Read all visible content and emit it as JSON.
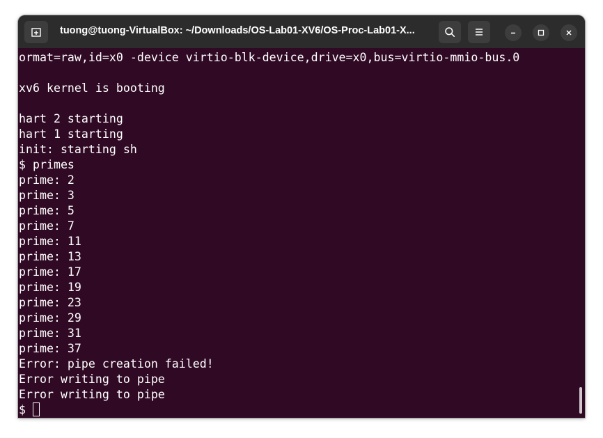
{
  "window": {
    "title": "tuong@tuong-VirtualBox: ~/Downloads/OS-Lab01-XV6/OS-Proc-Lab01-X..."
  },
  "toolbar": {
    "new_tab_icon": "new-tab-icon",
    "search_icon": "search-icon",
    "menu_icon": "hamburger-menu-icon",
    "minimize_icon": "minimize-icon",
    "maximize_icon": "maximize-icon",
    "close_icon": "close-icon"
  },
  "terminal": {
    "lines": [
      "ormat=raw,id=x0 -device virtio-blk-device,drive=x0,bus=virtio-mmio-bus.0",
      "",
      "xv6 kernel is booting",
      "",
      "hart 2 starting",
      "hart 1 starting",
      "init: starting sh",
      "$ primes",
      "prime: 2",
      "prime: 3",
      "prime: 5",
      "prime: 7",
      "prime: 11",
      "prime: 13",
      "prime: 17",
      "prime: 19",
      "prime: 23",
      "prime: 29",
      "prime: 31",
      "prime: 37",
      "Error: pipe creation failed!",
      "Error writing to pipe",
      "Error writing to pipe"
    ],
    "prompt": "$ "
  },
  "colors": {
    "terminal_bg": "#300a24",
    "titlebar_bg": "#2c2c2c",
    "text": "#ffffff"
  }
}
